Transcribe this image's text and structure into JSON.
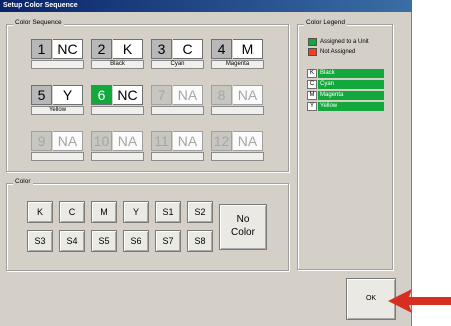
{
  "window": {
    "title": "Setup Color Sequence"
  },
  "color_sequence": {
    "group_title": "Color Sequence",
    "cells": [
      {
        "number": "1",
        "value": "NC",
        "label": ""
      },
      {
        "number": "2",
        "value": "K",
        "label": "Black"
      },
      {
        "number": "3",
        "value": "C",
        "label": "Cyan"
      },
      {
        "number": "4",
        "value": "M",
        "label": "Magenta"
      },
      {
        "number": "5",
        "value": "Y",
        "label": "Yellow"
      },
      {
        "number": "6",
        "value": "NC",
        "label": ""
      },
      {
        "number": "7",
        "value": "NA",
        "label": ""
      },
      {
        "number": "8",
        "value": "NA",
        "label": ""
      },
      {
        "number": "9",
        "value": "NA",
        "label": ""
      },
      {
        "number": "10",
        "value": "NA",
        "label": ""
      },
      {
        "number": "11",
        "value": "NA",
        "label": ""
      },
      {
        "number": "12",
        "value": "NA",
        "label": ""
      }
    ]
  },
  "color_group": {
    "group_title": "Color",
    "buttons": [
      "K",
      "C",
      "M",
      "Y",
      "S1",
      "S2",
      "S3",
      "S4",
      "S5",
      "S6",
      "S7",
      "S8"
    ],
    "no_color_line1": "No",
    "no_color_line2": "Color"
  },
  "legend": {
    "group_title": "Color Legend",
    "assigned_label": "Assigned to a Unit",
    "not_assigned_label": "Not Assigned",
    "assigned_color": "#12a83c",
    "not_assigned_color": "#ff3b1f",
    "mappings": [
      {
        "letter": "K",
        "name": "Black"
      },
      {
        "letter": "C",
        "name": "Cyan"
      },
      {
        "letter": "M",
        "name": "Magenta"
      },
      {
        "letter": "Y",
        "name": "Yellow"
      }
    ]
  },
  "ok_button": {
    "label": "OK"
  },
  "arrow": {
    "icon": "red-pointer-arrow-icon",
    "color": "#d62e20"
  }
}
